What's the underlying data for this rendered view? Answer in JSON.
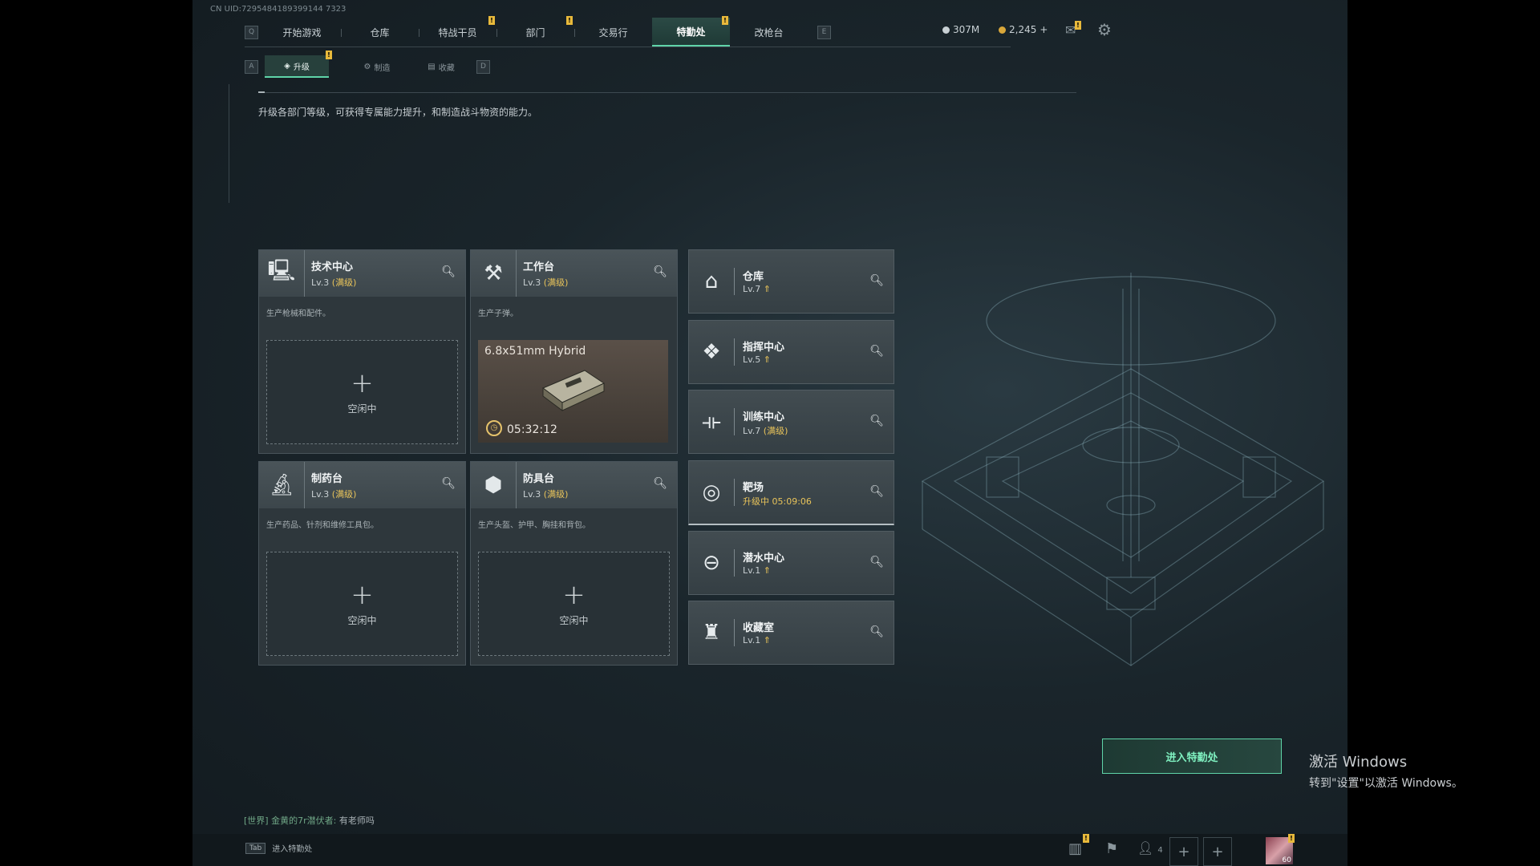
{
  "uid": "CN UID:7295484189399144 7323",
  "topnav": {
    "left_key": "Q",
    "right_key": "E",
    "tabs": [
      {
        "label": "开始游戏"
      },
      {
        "label": "仓库"
      },
      {
        "label": "特战干员",
        "badge": "!"
      },
      {
        "label": "部门",
        "badge": "!"
      },
      {
        "label": "交易行"
      },
      {
        "label": "特勤处",
        "badge": "!",
        "active": true
      },
      {
        "label": "改枪台"
      }
    ]
  },
  "resources": {
    "silver": "307M",
    "gold": "2,245",
    "gold_add": "+"
  },
  "subnav": {
    "left_key": "A",
    "right_key": "D",
    "tabs": [
      {
        "label": "升级",
        "badge": "!"
      },
      {
        "label": "制造"
      },
      {
        "label": "收藏"
      }
    ]
  },
  "description": "升级各部门等级，可获得专属能力提升，和制造战斗物资的能力。",
  "workshops": [
    {
      "name": "技术中心",
      "level": "Lv.3",
      "level_tag": "(满级)",
      "desc": "生产枪械和配件。",
      "slot": "空闲中",
      "icon": "computer-icon"
    },
    {
      "name": "工作台",
      "level": "Lv.3",
      "level_tag": "(满级)",
      "desc": "生产子弹。",
      "craft_item": "6.8x51mm Hybrid",
      "craft_time": "05:32:12",
      "icon": "tools-icon"
    },
    {
      "name": "制药台",
      "level": "Lv.3",
      "level_tag": "(满级)",
      "desc": "生产药品、针剂和维修工具包。",
      "slot": "空闲中",
      "icon": "microscope-icon"
    },
    {
      "name": "防具台",
      "level": "Lv.3",
      "level_tag": "(满级)",
      "desc": "生产头盔、护甲、胸挂和背包。",
      "slot": "空闲中",
      "icon": "armor-icon"
    }
  ],
  "plus_symbol": "+",
  "departments": [
    {
      "name": "仓库",
      "level": "Lv.7",
      "upgradable": true,
      "icon": "warehouse-icon"
    },
    {
      "name": "指挥中心",
      "level": "Lv.5",
      "upgradable": true,
      "icon": "command-icon"
    },
    {
      "name": "训练中心",
      "level": "Lv.7",
      "level_tag": "(满级)",
      "icon": "dumbbell-icon"
    },
    {
      "name": "靶场",
      "status": "升级中 05:09:06",
      "icon": "target-icon"
    },
    {
      "name": "潜水中心",
      "level": "Lv.1",
      "upgradable": true,
      "icon": "diving-mask-icon"
    },
    {
      "name": "收藏室",
      "level": "Lv.1",
      "upgradable": true,
      "icon": "trophy-icon"
    }
  ],
  "enter_button": "进入特勤处",
  "chat": {
    "channel": "[世界]",
    "user": "金黄的7r潜伏者:",
    "message": "有老师吗"
  },
  "bottom": {
    "tab_key": "Tab",
    "tab_label": "进入特勤处",
    "friends_count": "4",
    "avatar_level": "60"
  },
  "watermark": {
    "line1": "激活 Windows",
    "line2": "转到\"设置\"以激活 Windows。"
  },
  "colors": {
    "accent": "#5fd4a8",
    "max_level": "#e8c35a",
    "badge": "#e8b93b"
  }
}
